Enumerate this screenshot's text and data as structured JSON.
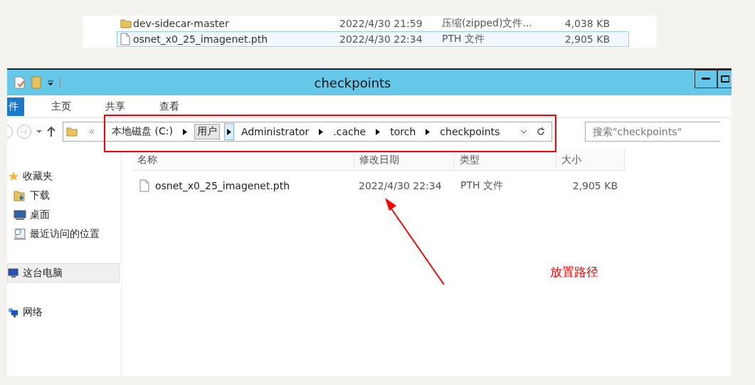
{
  "top_snippet": {
    "rows": [
      {
        "kind": "folder",
        "name": "dev-sidecar-master",
        "date": "2022/4/30 21:59",
        "type": "压缩(zipped)文件...",
        "size": "4,038 KB",
        "selected": false
      },
      {
        "kind": "file",
        "name": "osnet_x0_25_imagenet.pth",
        "date": "2022/4/30 22:34",
        "type": "PTH 文件",
        "size": "2,905 KB",
        "selected": true
      }
    ]
  },
  "window": {
    "title": "checkpoints"
  },
  "ribbon_tabs": [
    {
      "label": "件",
      "selected": true
    },
    {
      "label": "主页",
      "selected": false
    },
    {
      "label": "共享",
      "selected": false
    },
    {
      "label": "查看",
      "selected": false
    }
  ],
  "address": {
    "crumbs": [
      {
        "label": "本地磁盘 (C:)",
        "selected": false
      },
      {
        "label": "用户",
        "selected": true
      },
      {
        "label": "Administrator",
        "selected": false
      },
      {
        "label": ".cache",
        "selected": false
      },
      {
        "label": "torch",
        "selected": false
      },
      {
        "label": "checkpoints",
        "selected": false
      }
    ]
  },
  "search": {
    "placeholder": "搜索\"checkpoints\""
  },
  "sidebar": {
    "items": [
      {
        "kind": "star",
        "label": "收藏夹",
        "selected": false,
        "children": [
          {
            "kind": "download",
            "label": "下载",
            "selected": false
          },
          {
            "kind": "desktop",
            "label": "桌面",
            "selected": false
          },
          {
            "kind": "recent",
            "label": "最近访问的位置",
            "selected": false
          }
        ]
      },
      {
        "kind": "pc",
        "label": "这台电脑",
        "selected": true
      },
      {
        "kind": "network",
        "label": "网络",
        "selected": false
      }
    ]
  },
  "table": {
    "columns": [
      "名称",
      "修改日期",
      "类型",
      "大小"
    ],
    "rows": [
      {
        "name": "osnet_x0_25_imagenet.pth",
        "date": "2022/4/30 22:34",
        "type": "PTH 文件",
        "size": "2,905 KB"
      }
    ]
  },
  "annotation": {
    "text": "放置路径"
  }
}
